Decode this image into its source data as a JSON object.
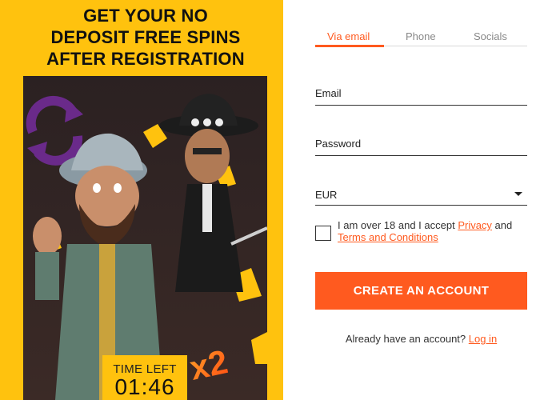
{
  "promo": {
    "headline_line1": "GET YOUR NO",
    "headline_line2": "DEPOSIT FREE SPINS",
    "headline_line3": "AFTER REGISTRATION",
    "multiplier_text": "x2",
    "timer_label": "TIME LEFT",
    "timer_value": "01:46"
  },
  "tabs": [
    {
      "label": "Via email",
      "active": true
    },
    {
      "label": "Phone",
      "active": false
    },
    {
      "label": "Socials",
      "active": false
    }
  ],
  "form": {
    "email_placeholder": "Email",
    "password_placeholder": "Password",
    "currency_value": "EUR",
    "consent_prefix": "I am over 18 and I accept ",
    "consent_privacy_link": "Privacy",
    "consent_and": " and ",
    "consent_terms_link": "Terms and Conditions",
    "submit_label": "CREATE AN ACCOUNT",
    "login_prompt": "Already have an account? ",
    "login_link": "Log in"
  },
  "colors": {
    "brand_yellow": "#ffc20e",
    "accent_orange": "#ff5a1f"
  },
  "icons": {
    "refresh": "refresh-icon",
    "dropdown": "chevron-down-icon"
  }
}
